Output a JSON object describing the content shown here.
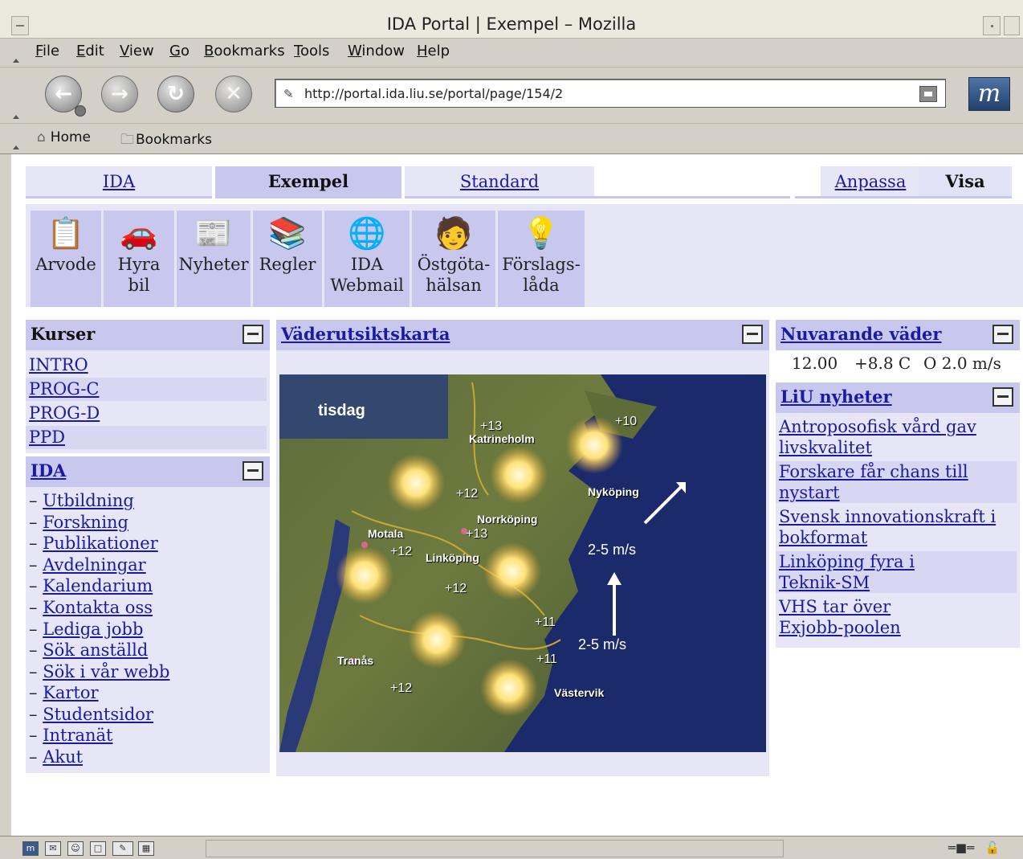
{
  "window": {
    "title": "IDA Portal | Exempel – Mozilla"
  },
  "menu": [
    "File",
    "Edit",
    "View",
    "Go",
    "Bookmarks",
    "Tools",
    "Window",
    "Help"
  ],
  "nav": {
    "url": "http://portal.ida.liu.se/portal/page/154/2"
  },
  "personal": {
    "home": "Home",
    "bookmarks": "Bookmarks"
  },
  "tabs": {
    "ida": "IDA",
    "exempel": "Exempel",
    "standard": "Standard",
    "anpassa": "Anpassa",
    "visa": "Visa"
  },
  "apps": [
    {
      "line1": "Arvode",
      "line2": "",
      "icon": "checklist-icon"
    },
    {
      "line1": "Hyra",
      "line2": "bil",
      "icon": "car-icon"
    },
    {
      "line1": "Nyheter",
      "line2": "",
      "icon": "newspaper-icon"
    },
    {
      "line1": "Regler",
      "line2": "",
      "icon": "books-icon"
    },
    {
      "line1": "IDA",
      "line2": "Webmail",
      "icon": "mail-globe-icon"
    },
    {
      "line1": "Östgöta-",
      "line2": "hälsan",
      "icon": "health-icon"
    },
    {
      "line1": "Förslags-",
      "line2": "låda",
      "icon": "lightbulb-icon"
    }
  ],
  "kurser": {
    "title": "Kurser",
    "items": [
      "INTRO",
      "PROG-C",
      "PROG-D",
      "PPD"
    ]
  },
  "ida": {
    "title": "IDA",
    "items": [
      "Utbildning",
      "Forskning",
      "Publikationer",
      "Avdelningar",
      "Kalendarium",
      "Kontakta oss",
      "Lediga jobb",
      "Sök anställd",
      "Sök i vår webb",
      "Kartor",
      "Studentsidor",
      "Intranät",
      "Akut"
    ]
  },
  "weather_map": {
    "title": "Väderutsiktskarta",
    "day": "tisdag",
    "labels": {
      "katrineholm": "Katrineholm",
      "nykoping": "Nyköping",
      "norrkoping": "Norrköping",
      "motala": "Motala",
      "linkoping": "Linköping",
      "tranas": "Tranås",
      "vastervik": "Västervik"
    },
    "temps": [
      "+13",
      "+10",
      "+12",
      "+13",
      "+12",
      "+12",
      "+11",
      "+11",
      "+12"
    ],
    "wind1": "2-5 m/s",
    "wind2": "2-5 m/s"
  },
  "current_weather": {
    "title": "Nuvarande väder",
    "time": "12.00",
    "temp": "+8.8 C",
    "wind": "O 2.0 m/s"
  },
  "liu_news": {
    "title": "LiU nyheter",
    "items": [
      {
        "l1": "Antroposofisk vård gav",
        "l2": "livskvalitet"
      },
      {
        "l1": "Forskare får chans till",
        "l2": "nystart"
      },
      {
        "l1": "Svensk innovationskraft i",
        "l2": "bokformat"
      },
      {
        "l1": "Linköping fyra i",
        "l2": "Teknik-SM"
      },
      {
        "l1": "VHS tar över",
        "l2": "Exjobb-poolen"
      }
    ]
  }
}
